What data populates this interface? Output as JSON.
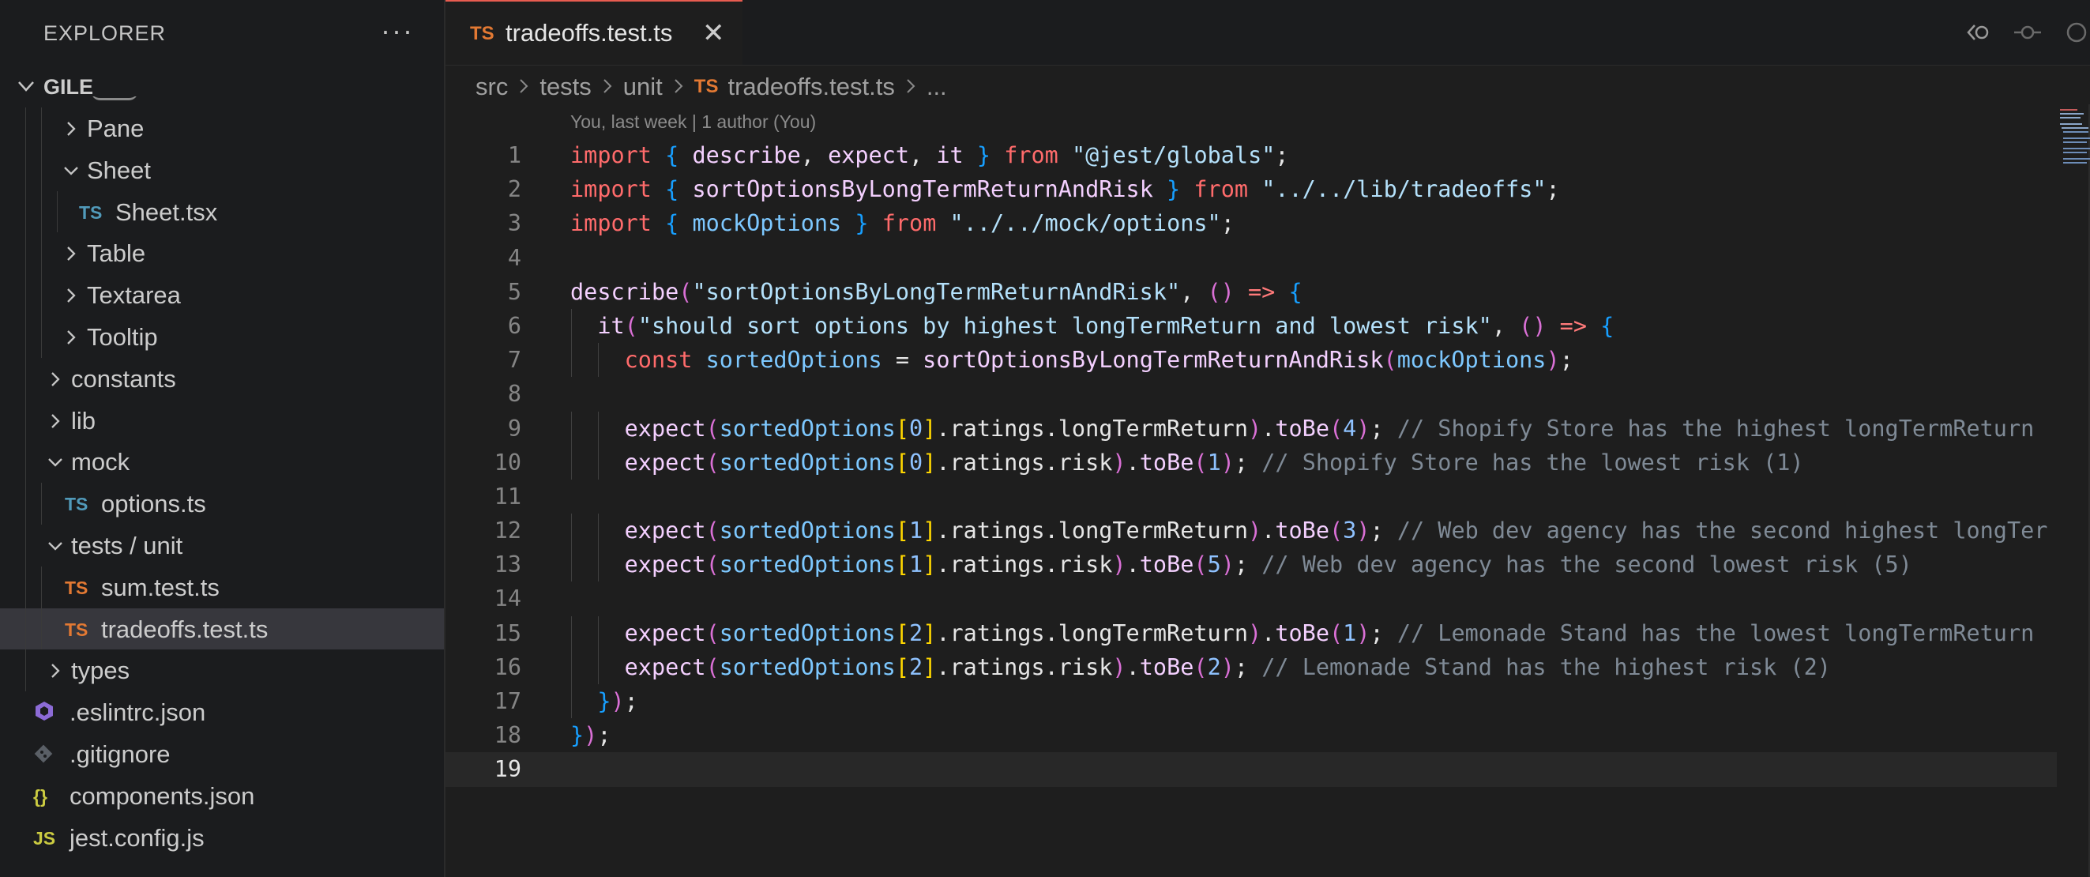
{
  "sidebar": {
    "title": "EXPLORER",
    "more_label": "···",
    "root_label": "GILE",
    "items": [
      {
        "label": "Pane",
        "type": "folder",
        "expanded": false,
        "depth": 3
      },
      {
        "label": "Sheet",
        "type": "folder",
        "expanded": true,
        "depth": 3
      },
      {
        "label": "Sheet.tsx",
        "type": "file",
        "icon": "TS",
        "depth": 4
      },
      {
        "label": "Table",
        "type": "folder",
        "expanded": false,
        "depth": 3
      },
      {
        "label": "Textarea",
        "type": "folder",
        "expanded": false,
        "depth": 3
      },
      {
        "label": "Tooltip",
        "type": "folder",
        "expanded": false,
        "depth": 3
      },
      {
        "label": "constants",
        "type": "folder",
        "expanded": false,
        "depth": 2
      },
      {
        "label": "lib",
        "type": "folder",
        "expanded": false,
        "depth": 2
      },
      {
        "label": "mock",
        "type": "folder",
        "expanded": true,
        "depth": 2
      },
      {
        "label": "options.ts",
        "type": "file",
        "icon": "TS",
        "depth": 3
      },
      {
        "label": "tests / unit",
        "type": "folder",
        "expanded": true,
        "depth": 2
      },
      {
        "label": "sum.test.ts",
        "type": "file",
        "icon": "TS",
        "depth": 3
      },
      {
        "label": "tradeoffs.test.ts",
        "type": "file",
        "icon": "TS",
        "depth": 3,
        "selected": true
      },
      {
        "label": "types",
        "type": "folder",
        "expanded": false,
        "depth": 2
      },
      {
        "label": ".eslintrc.json",
        "type": "file",
        "icon": "eslint-icon",
        "depth": 1
      },
      {
        "label": ".gitignore",
        "type": "file",
        "icon": "git-icon",
        "depth": 1
      },
      {
        "label": "components.json",
        "type": "file",
        "icon": "{}",
        "depth": 1
      },
      {
        "label": "jest.config.js",
        "type": "file",
        "icon": "JS",
        "depth": 1
      }
    ]
  },
  "tab": {
    "icon": "TS",
    "name": "tradeoffs.test.ts",
    "close": "✕"
  },
  "breadcrumb": {
    "src": "src",
    "tests": "tests",
    "unit": "unit",
    "file_icon": "TS",
    "file": "tradeoffs.test.ts",
    "more": "..."
  },
  "blame": "You, last week | 1 author (You)",
  "code": {
    "active_line": 19,
    "lines": [
      "import { describe, expect, it } from \"@jest/globals\";",
      "import { sortOptionsByLongTermReturnAndRisk } from \"../../lib/tradeoffs\";",
      "import { mockOptions } from \"../../mock/options\";",
      "",
      "describe(\"sortOptionsByLongTermReturnAndRisk\", () => {",
      "  it(\"should sort options by highest longTermReturn and lowest risk\", () => {",
      "    const sortedOptions = sortOptionsByLongTermReturnAndRisk(mockOptions);",
      "",
      "    expect(sortedOptions[0].ratings.longTermReturn).toBe(4); // Shopify Store has the highest longTermReturn",
      "    expect(sortedOptions[0].ratings.risk).toBe(1); // Shopify Store has the lowest risk (1)",
      "",
      "    expect(sortedOptions[1].ratings.longTermReturn).toBe(3); // Web dev agency has the second highest longTer",
      "    expect(sortedOptions[1].ratings.risk).toBe(5); // Web dev agency has the second lowest risk (5)",
      "",
      "    expect(sortedOptions[2].ratings.longTermReturn).toBe(1); // Lemonade Stand has the lowest longTermReturn",
      "    expect(sortedOptions[2].ratings.risk).toBe(2); // Lemonade Stand has the highest risk (2)",
      "  });",
      "});",
      ""
    ]
  },
  "colors": {
    "accent_tab_border": "#e85c50",
    "ts_orange": "#e37933",
    "ts_blue": "#519aba",
    "selected_row": "#37373d",
    "keyword": "#ff6b6b",
    "string": "#b4e1fb",
    "comment": "#7f8a96"
  },
  "toolbar_icons": [
    "go-back-icon",
    "timeline-icon",
    "compare-icon"
  ]
}
